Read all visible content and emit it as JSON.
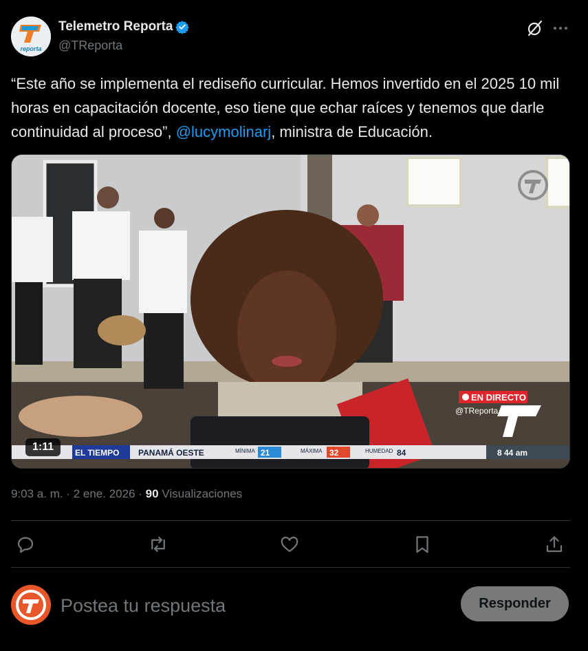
{
  "author": {
    "display_name": "Telemetro Reporta",
    "handle": "@TReporta",
    "avatar_text": "reporta",
    "verified_color": "#1d9bf0"
  },
  "tweet": {
    "text_before": "“Este año se implementa el rediseño curricular. Hemos invertido en el 2025 10 mil horas en capacitación docente, eso tiene que echar raíces y tenemos que darle continuidad al proceso”, ",
    "mention": "@lucymolinarj",
    "text_after": ", ministra de Educación."
  },
  "media": {
    "duration": "1:11",
    "live_badge": "EN DIRECTO",
    "channel_handle": "@TReporta",
    "ticker": {
      "section": "EL TIEMPO",
      "location": "PANAMÁ OESTE",
      "min_label": "MÍNIMA",
      "min_value": "21",
      "max_label": "MÁXIMA",
      "max_value": "32",
      "humidity_label": "HUMEDAD",
      "humidity_value": "84",
      "time": "8 44 am"
    }
  },
  "meta": {
    "time": "9:03 a. m.",
    "separator": " · ",
    "date": "2 ene. 2026",
    "separator2": " · ",
    "views_count": "90",
    "views_label": "Visualizaciones"
  },
  "actions": [
    "reply-icon",
    "retweet-icon",
    "like-icon",
    "bookmark-icon",
    "share-icon"
  ],
  "reply": {
    "placeholder": "Postea tu respuesta",
    "button_label": "Responder"
  },
  "colors": {
    "background": "#000000",
    "text": "#e7e9ea",
    "muted": "#71767b",
    "accent": "#1d9bf0",
    "divider": "#2f3336",
    "live_red": "#e0262c"
  }
}
